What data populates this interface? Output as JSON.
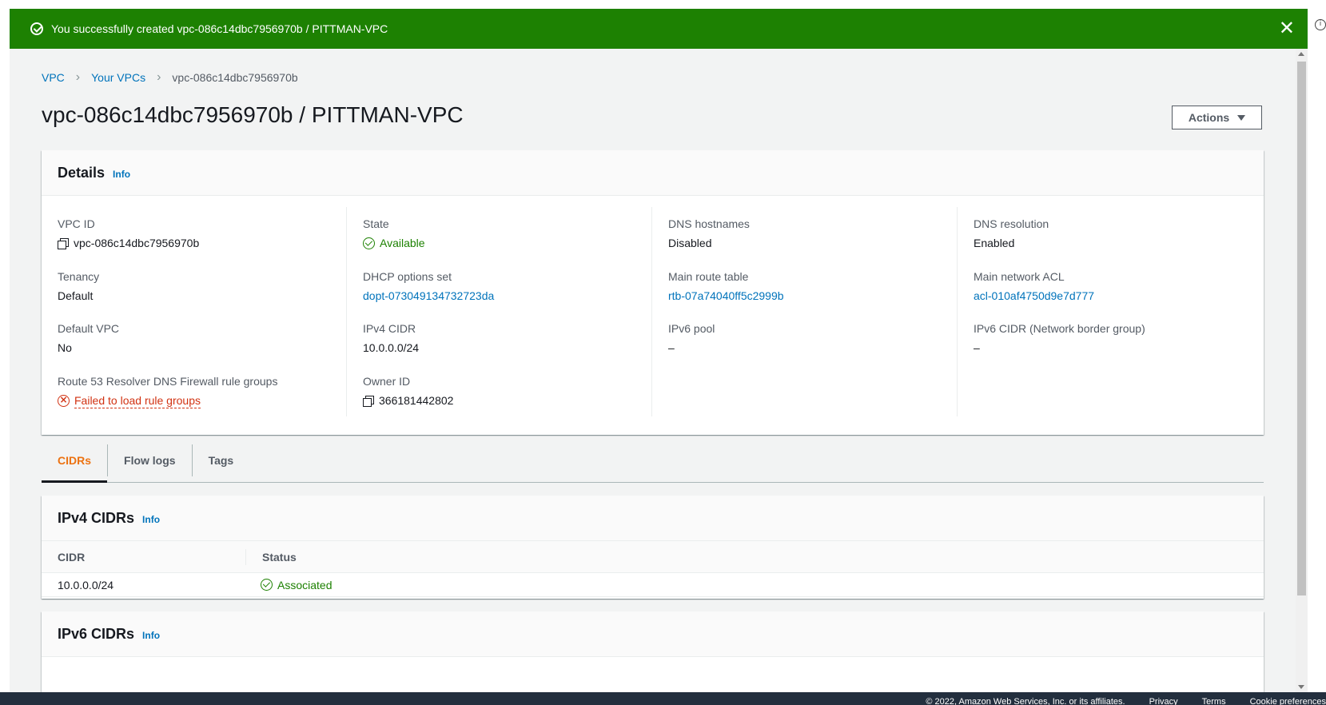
{
  "flash": {
    "message": "You successfully created vpc-086c14dbc7956970b / PITTMAN-VPC",
    "close_glyph": "✕"
  },
  "breadcrumb": {
    "items": [
      "VPC",
      "Your VPCs"
    ],
    "current": "vpc-086c14dbc7956970b"
  },
  "page": {
    "title": "vpc-086c14dbc7956970b / PITTMAN-VPC",
    "actions_label": "Actions"
  },
  "details": {
    "heading": "Details",
    "info": "Info",
    "columns": [
      [
        {
          "label": "VPC ID",
          "value": "vpc-086c14dbc7956970b"
        },
        {
          "label": "Tenancy",
          "value": "Default"
        },
        {
          "label": "Default VPC",
          "value": "No"
        },
        {
          "label": "Route 53 Resolver DNS Firewall rule groups",
          "value": "Failed to load rule groups"
        }
      ],
      [
        {
          "label": "State",
          "value": "Available"
        },
        {
          "label": "DHCP options set",
          "value": "dopt-073049134732723da"
        },
        {
          "label": "IPv4 CIDR",
          "value": "10.0.0.0/24"
        },
        {
          "label": "Owner ID",
          "value": "366181442802"
        }
      ],
      [
        {
          "label": "DNS hostnames",
          "value": "Disabled"
        },
        {
          "label": "Main route table",
          "value": "rtb-07a74040ff5c2999b"
        },
        {
          "label": "IPv6 pool",
          "value": "–"
        }
      ],
      [
        {
          "label": "DNS resolution",
          "value": "Enabled"
        },
        {
          "label": "Main network ACL",
          "value": "acl-010af4750d9e7d777"
        },
        {
          "label": "IPv6 CIDR (Network border group)",
          "value": "–"
        }
      ]
    ]
  },
  "tabs": [
    "CIDRs",
    "Flow logs",
    "Tags"
  ],
  "ipv4": {
    "heading": "IPv4 CIDRs",
    "info": "Info",
    "columns": [
      "CIDR",
      "Status"
    ],
    "rows": [
      {
        "cidr": "10.0.0.0/24",
        "status": "Associated"
      }
    ]
  },
  "ipv6": {
    "heading": "IPv6 CIDRs",
    "info": "Info"
  },
  "footer": {
    "copyright": "© 2022, Amazon Web Services, Inc. or its affiliates.",
    "links": [
      "Privacy",
      "Terms",
      "Cookie preferences"
    ]
  },
  "colors": {
    "success": "#1d8102",
    "link": "#0073bb",
    "error": "#d13212",
    "active_tab": "#ec7211",
    "footer_bg": "#232f3e"
  }
}
